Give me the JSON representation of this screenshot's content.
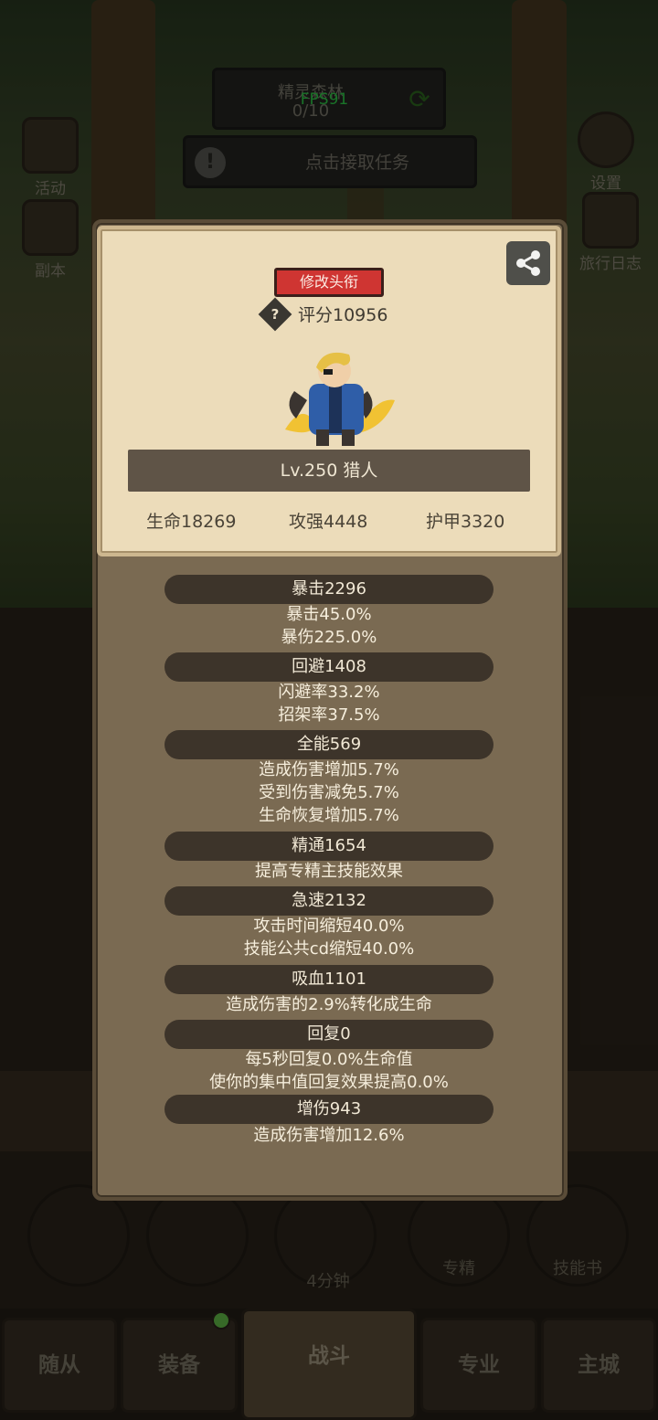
{
  "hud": {
    "map_name": "精灵森林",
    "map_progress": "0/10",
    "fps": "FPS91",
    "task_label": "点击接取任务",
    "activity": "活动",
    "dungeon": "副本",
    "settings": "设置",
    "travel_log": "旅行日志"
  },
  "popup": {
    "edit_title_btn": "修改头衔",
    "score": "评分10956",
    "level_class": "Lv.250 猎人",
    "hp": "生命18269",
    "attack": "攻强4448",
    "armor": "护甲3320",
    "stats": [
      {
        "header": "暴击2296",
        "lines": [
          "暴击45.0%",
          "暴伤225.0%"
        ]
      },
      {
        "header": "回避1408",
        "lines": [
          "闪避率33.2%",
          "招架率37.5%"
        ]
      },
      {
        "header": "全能569",
        "lines": [
          "造成伤害增加5.7%",
          "受到伤害减免5.7%",
          "生命恢复增加5.7%"
        ]
      },
      {
        "header": "精通1654",
        "lines": [
          "提高专精主技能效果"
        ]
      },
      {
        "header": "急速2132",
        "lines": [
          "攻击时间缩短40.0%",
          "技能公共cd缩短40.0%"
        ]
      },
      {
        "header": "吸血1101",
        "lines": [
          "造成伤害的2.9%转化成生命"
        ]
      },
      {
        "header": "回复0",
        "lines": [
          "每5秒回复0.0%生命值",
          "使你的集中值回复效果提高0.0%"
        ]
      },
      {
        "header": "增伤943",
        "lines": [
          "造成伤害增加12.6%"
        ]
      }
    ]
  },
  "bottom": {
    "timer": "4分钟",
    "specialization": "专精",
    "skill_book": "技能书",
    "tabs": [
      "随从",
      "装备",
      "战斗",
      "专业",
      "主城"
    ]
  },
  "colors": {
    "panel_bg": "#7a6a52",
    "card_bg": "#ecdcba",
    "title_btn": "#cf3532",
    "fps_green": "#2fd24a"
  }
}
